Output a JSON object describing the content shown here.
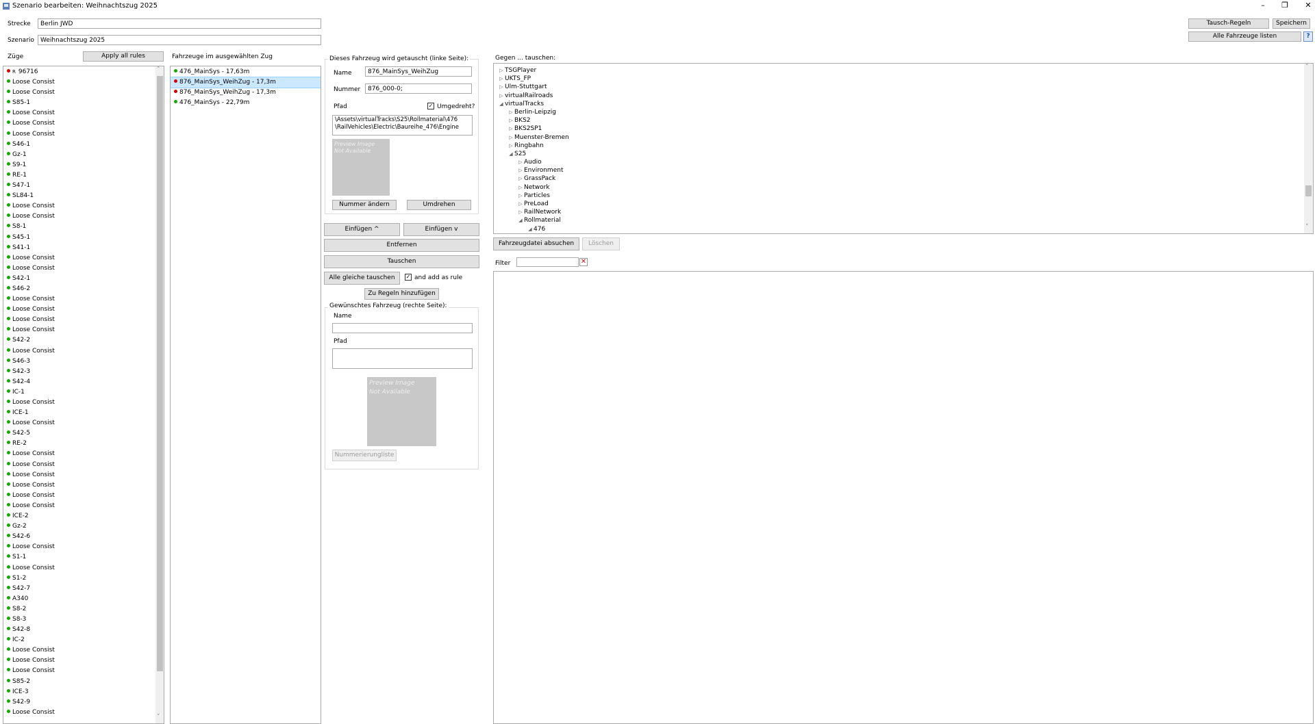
{
  "window": {
    "title": "Szenario bearbeiten: Weihnachtszug 2025",
    "minimize": "–",
    "restore": "❐",
    "close": "✕"
  },
  "header": {
    "strecke_label": "Strecke",
    "strecke_value": "Berlin JWD",
    "szenario_label": "Szenario",
    "szenario_value": "Weihnachtszug 2025",
    "tausch_regeln": "Tausch-Regeln",
    "speichern": "Speichern",
    "alle_fahrzeuge": "Alle Fahrzeuge listen",
    "help": "?"
  },
  "trains": {
    "label": "Züge",
    "apply_all": "Apply all rules",
    "items": [
      {
        "name": "96716",
        "status": "red",
        "flag": "R"
      },
      {
        "name": "Loose Consist",
        "status": "green"
      },
      {
        "name": "Loose Consist",
        "status": "green"
      },
      {
        "name": "S85-1",
        "status": "green"
      },
      {
        "name": "Loose Consist",
        "status": "green"
      },
      {
        "name": "Loose Consist",
        "status": "green"
      },
      {
        "name": "Loose Consist",
        "status": "green"
      },
      {
        "name": "S46-1",
        "status": "green"
      },
      {
        "name": "Gz-1",
        "status": "green"
      },
      {
        "name": "S9-1",
        "status": "green"
      },
      {
        "name": "RE-1",
        "status": "green"
      },
      {
        "name": "S47-1",
        "status": "green"
      },
      {
        "name": "SL84-1",
        "status": "green"
      },
      {
        "name": "Loose Consist",
        "status": "green"
      },
      {
        "name": "Loose Consist",
        "status": "green"
      },
      {
        "name": "S8-1",
        "status": "green"
      },
      {
        "name": "S45-1",
        "status": "green"
      },
      {
        "name": "S41-1",
        "status": "green"
      },
      {
        "name": "Loose Consist",
        "status": "green"
      },
      {
        "name": "Loose Consist",
        "status": "green"
      },
      {
        "name": "S42-1",
        "status": "green"
      },
      {
        "name": "S46-2",
        "status": "green"
      },
      {
        "name": "Loose Consist",
        "status": "green"
      },
      {
        "name": "Loose Consist",
        "status": "green"
      },
      {
        "name": "Loose Consist",
        "status": "green"
      },
      {
        "name": "Loose Consist",
        "status": "green"
      },
      {
        "name": "S42-2",
        "status": "green"
      },
      {
        "name": "Loose Consist",
        "status": "green"
      },
      {
        "name": "S46-3",
        "status": "green"
      },
      {
        "name": "S42-3",
        "status": "green"
      },
      {
        "name": "S42-4",
        "status": "green"
      },
      {
        "name": "IC-1",
        "status": "green"
      },
      {
        "name": "Loose Consist",
        "status": "green"
      },
      {
        "name": "ICE-1",
        "status": "green"
      },
      {
        "name": "Loose Consist",
        "status": "green"
      },
      {
        "name": "S42-5",
        "status": "green"
      },
      {
        "name": "RE-2",
        "status": "green"
      },
      {
        "name": "Loose Consist",
        "status": "green"
      },
      {
        "name": "Loose Consist",
        "status": "green"
      },
      {
        "name": "Loose Consist",
        "status": "green"
      },
      {
        "name": "Loose Consist",
        "status": "green"
      },
      {
        "name": "Loose Consist",
        "status": "green"
      },
      {
        "name": "Loose Consist",
        "status": "green"
      },
      {
        "name": "ICE-2",
        "status": "green"
      },
      {
        "name": "Gz-2",
        "status": "green"
      },
      {
        "name": "S42-6",
        "status": "green"
      },
      {
        "name": "Loose Consist",
        "status": "green"
      },
      {
        "name": "S1-1",
        "status": "green"
      },
      {
        "name": "Loose Consist",
        "status": "green"
      },
      {
        "name": "S1-2",
        "status": "green"
      },
      {
        "name": "S42-7",
        "status": "green"
      },
      {
        "name": "A340",
        "status": "green"
      },
      {
        "name": "S8-2",
        "status": "green"
      },
      {
        "name": "S8-3",
        "status": "green"
      },
      {
        "name": "S42-8",
        "status": "green"
      },
      {
        "name": "IC-2",
        "status": "green"
      },
      {
        "name": "Loose Consist",
        "status": "green"
      },
      {
        "name": "Loose Consist",
        "status": "green"
      },
      {
        "name": "Loose Consist",
        "status": "green"
      },
      {
        "name": "S85-2",
        "status": "green"
      },
      {
        "name": "ICE-3",
        "status": "green"
      },
      {
        "name": "S42-9",
        "status": "green"
      },
      {
        "name": "Loose Consist",
        "status": "green"
      }
    ]
  },
  "vehicles": {
    "label": "Fahrzeuge im ausgewählten Zug",
    "items": [
      {
        "name": "476_MainSys - 17,63m",
        "status": "green",
        "selected": false
      },
      {
        "name": "876_MainSys_WeihZug - 17,3m",
        "status": "red",
        "selected": true
      },
      {
        "name": "876_MainSys_WeihZug - 17,3m",
        "status": "red",
        "selected": false
      },
      {
        "name": "476_MainSys - 22,79m",
        "status": "green",
        "selected": false
      }
    ]
  },
  "left_side": {
    "group_label": "Dieses Fahrzeug wird getauscht (linke Seite):",
    "name_label": "Name",
    "name_value": "876_MainSys_WeihZug",
    "nummer_label": "Nummer",
    "nummer_value": "876_000-0;",
    "pfad_label": "Pfad",
    "umgedreht_label": "Umgedreht?",
    "umgedreht_checked": true,
    "pfad_lines": [
      "\\Assets\\virtualTracks\\S25\\Rollmaterial\\476",
      "\\RailVehicles\\Electric\\Baureihe_476\\Engine"
    ],
    "preview_line1": "Preview Image",
    "preview_line2": "Not Available",
    "nummer_aendern": "Nummer ändern",
    "umdrehen": "Umdrehen"
  },
  "actions": {
    "einfuegen_up": "Einfügen ^",
    "einfuegen_down": "Einfügen v",
    "entfernen": "Entfernen",
    "tauschen": "Tauschen",
    "alle_gleiche": "Alle gleiche tauschen",
    "add_rule_label": "and add as rule",
    "add_rule_checked": true,
    "zu_regeln": "Zu Regeln hinzufügen"
  },
  "right_side": {
    "group_label": "Gewünschtes Fahrzeug (rechte Seite):",
    "name_label": "Name",
    "pfad_label": "Pfad",
    "preview_line1": "Preview Image",
    "preview_line2": "Not Available",
    "nummerierungliste": "Nummerierungliste"
  },
  "tree": {
    "label": "Gegen ... tauschen:",
    "nodes": [
      {
        "text": "TSGPlayer",
        "level": 0,
        "expanded": false
      },
      {
        "text": "UKTS_FP",
        "level": 0,
        "expanded": false
      },
      {
        "text": "Ulm-Stuttgart",
        "level": 0,
        "expanded": false
      },
      {
        "text": "virtualRailroads",
        "level": 0,
        "expanded": false
      },
      {
        "text": "virtualTracks",
        "level": 0,
        "expanded": true
      },
      {
        "text": "Berlin-Leipzig",
        "level": 1,
        "expanded": false
      },
      {
        "text": "BKS2",
        "level": 1,
        "expanded": false
      },
      {
        "text": "BKS2SP1",
        "level": 1,
        "expanded": false
      },
      {
        "text": "Muenster-Bremen",
        "level": 1,
        "expanded": false
      },
      {
        "text": "Ringbahn",
        "level": 1,
        "expanded": false
      },
      {
        "text": "S25",
        "level": 1,
        "expanded": true
      },
      {
        "text": "Audio",
        "level": 2,
        "expanded": false
      },
      {
        "text": "Environment",
        "level": 2,
        "expanded": false
      },
      {
        "text": "GrassPack",
        "level": 2,
        "expanded": false
      },
      {
        "text": "Network",
        "level": 2,
        "expanded": false
      },
      {
        "text": "Particles",
        "level": 2,
        "expanded": false
      },
      {
        "text": "PreLoad",
        "level": 2,
        "expanded": false
      },
      {
        "text": "RailNetwork",
        "level": 2,
        "expanded": false
      },
      {
        "text": "Rollmaterial",
        "level": 2,
        "expanded": true
      },
      {
        "text": "476",
        "level": 3,
        "expanded": true
      }
    ],
    "search_button": "Fahrzeugdatei absuchen",
    "delete_button": "Löschen",
    "filter_label": "Filter",
    "filter_value": ""
  },
  "icons": {
    "expanded": "◢",
    "collapsed": "▷",
    "clear": "✕",
    "up": "˄",
    "down": "˅",
    "check": "✓"
  },
  "colors": {
    "green": "#14a800",
    "red": "#d40000",
    "selection": "#cce8ff",
    "clear_red": "#d01010"
  }
}
